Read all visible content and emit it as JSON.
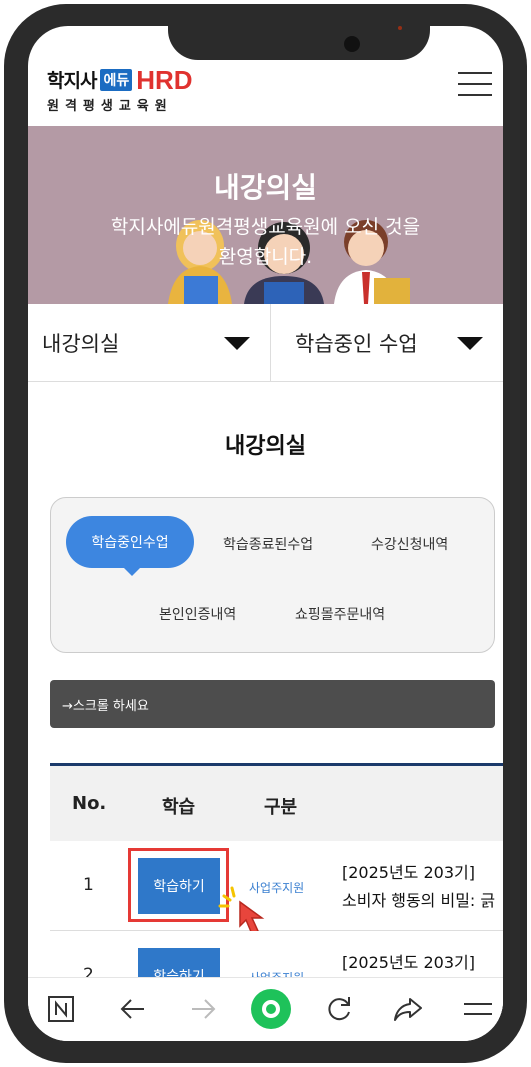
{
  "header": {
    "logo_main": "학지사",
    "logo_edu": "에듀",
    "logo_hrd": "HRD",
    "logo_sub": "원격평생교육원",
    "menu_icon": "hamburger-menu-icon"
  },
  "banner": {
    "title": "내강의실",
    "subtitle_line1": "학지사에듀원격평생교육원에 오신 것을",
    "subtitle_line2": "환영합니다.",
    "background_color": "#b49aa5"
  },
  "selects": {
    "primary": "내강의실",
    "secondary": "학습중인 수업"
  },
  "section_title": "내강의실",
  "tabs": {
    "active": "학습중인수업",
    "items": [
      "학습종료된수업",
      "수강신청내역",
      "본인인증내역",
      "쇼핑몰주문내역"
    ]
  },
  "scroll_hint": "→스크롤 하세요",
  "table": {
    "headers": [
      "No.",
      "학습",
      "구분"
    ],
    "rows": [
      {
        "no": "1",
        "button": "학습하기",
        "category": "사업주지원",
        "course_line1": "[2025년도 203기]",
        "course_line2": "소비자 행동의 비밀: 긁"
      },
      {
        "no": "2",
        "button": "학습하기",
        "category": "사업주지원",
        "course_line1": "[2025년도 203기]",
        "course_line2": ""
      }
    ]
  },
  "browser_bar": {
    "icons": [
      "n-logo-icon",
      "back-arrow-icon",
      "forward-arrow-icon",
      "home-circle-icon",
      "refresh-icon",
      "share-icon",
      "menu-lines-icon"
    ]
  },
  "colors": {
    "accent_blue": "#3d86e0",
    "button_blue": "#2f78c9",
    "highlight_red": "#e53935",
    "brand_red": "#e0322f"
  }
}
